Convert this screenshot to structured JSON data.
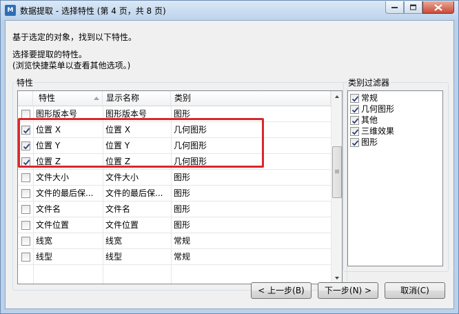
{
  "window": {
    "app_icon_text": "M",
    "title": "数据提取 - 选择特性 (第 4 页，共 8 页)"
  },
  "intro": {
    "line1": "基于选定的对象，找到以下特性。",
    "line2": "选择要提取的特性。",
    "line3": "(浏览快捷菜单以查看其他选项。)"
  },
  "properties": {
    "group_label": "特性",
    "columns": [
      "特性",
      "显示名称",
      "类别"
    ],
    "rows": [
      {
        "checked": false,
        "property": "图形版本号",
        "display_name": "图形版本号",
        "category": "图形"
      },
      {
        "checked": true,
        "property": "位置 X",
        "display_name": "位置 X",
        "category": "几何图形"
      },
      {
        "checked": true,
        "property": "位置 Y",
        "display_name": "位置 Y",
        "category": "几何图形"
      },
      {
        "checked": true,
        "property": "位置 Z",
        "display_name": "位置 Z",
        "category": "几何图形"
      },
      {
        "checked": false,
        "property": "文件大小",
        "display_name": "文件大小",
        "category": "图形"
      },
      {
        "checked": false,
        "property": "文件的最后保...",
        "display_name": "文件的最后保...",
        "category": "图形"
      },
      {
        "checked": false,
        "property": "文件名",
        "display_name": "文件名",
        "category": "图形"
      },
      {
        "checked": false,
        "property": "文件位置",
        "display_name": "文件位置",
        "category": "图形"
      },
      {
        "checked": false,
        "property": "线宽",
        "display_name": "线宽",
        "category": "常规"
      },
      {
        "checked": false,
        "property": "线型",
        "display_name": "线型",
        "category": "常规"
      }
    ]
  },
  "category_filter": {
    "group_label": "类别过滤器",
    "items": [
      {
        "label": "常规",
        "checked": true
      },
      {
        "label": "几何图形",
        "checked": true
      },
      {
        "label": "其他",
        "checked": true
      },
      {
        "label": "三维效果",
        "checked": true
      },
      {
        "label": "图形",
        "checked": true
      }
    ]
  },
  "buttons": {
    "back": "< 上一步(B)",
    "next": "下一步(N) >",
    "cancel": "取消(C)"
  },
  "colors": {
    "highlight_box": "#d9262c",
    "window_frame": "#b9d1ea",
    "close_button": "#c94a35"
  }
}
